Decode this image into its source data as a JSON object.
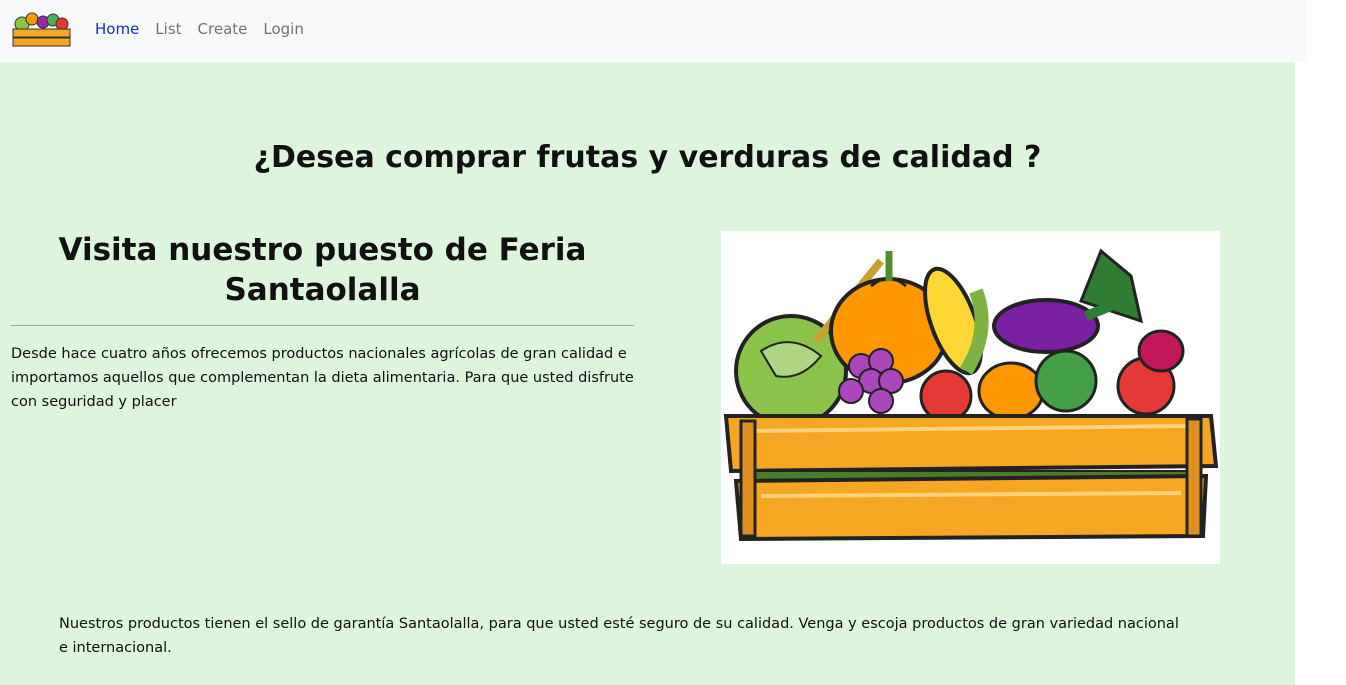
{
  "nav": {
    "logo_icon": "fruit-basket-logo-icon",
    "items": [
      {
        "label": "Home",
        "active": true
      },
      {
        "label": "List",
        "active": false
      },
      {
        "label": "Create",
        "active": false
      },
      {
        "label": "Login",
        "active": false
      }
    ]
  },
  "main": {
    "headline": "¿Desea comprar frutas y verduras de calidad ?",
    "subheading": "Visita nuestro puesto de Feria Santaolalla",
    "intro": "Desde hace cuatro años ofrecemos productos nacionales agrícolas de gran calidad e importamos aquellos que complementan la dieta alimentaria. Para que usted disfrute con seguridad y placer",
    "image_icon": "vegetable-crate-illustration",
    "footer": "Nuestros productos tienen el sello de garantía Santaolalla, para que usted esté seguro de su calidad. Venga y escoja productos de gran variedad nacional e internacional."
  },
  "colors": {
    "navbar_bg": "#f8f9fa",
    "content_bg": "#dcf5dc",
    "active_link": "#0d2fc9",
    "crate_orange": "#f5a623"
  }
}
